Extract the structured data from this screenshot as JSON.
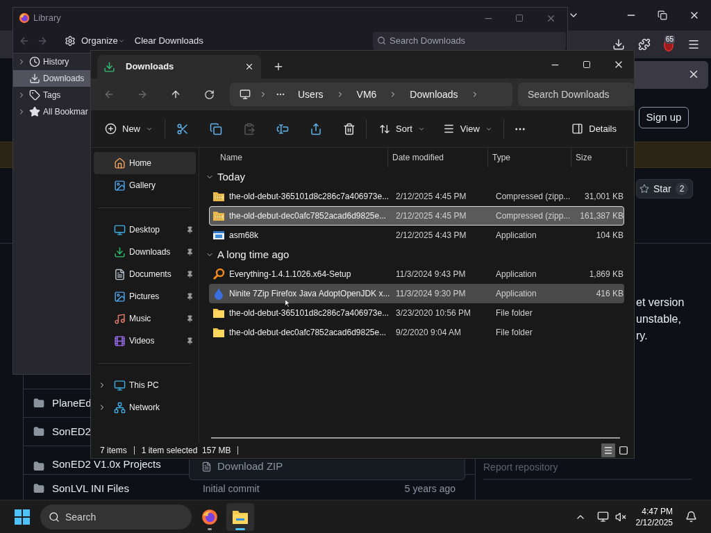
{
  "browser": {
    "toolbar_badge": "65",
    "sign_up": "Sign up",
    "star": {
      "label": "Star",
      "count": "2"
    },
    "about_lines": [
      "et version",
      "unstable,",
      "ry."
    ],
    "file_rows": [
      {
        "name": "PlaneEd"
      },
      {
        "name": "SonED2"
      },
      {
        "name": "SonED2 V1.0x Projects"
      },
      {
        "name": "SonLVL INI Files",
        "message": "Initial commit",
        "age": "5 years ago"
      }
    ],
    "menu_item": "Download ZIP",
    "report": "Report repository"
  },
  "library": {
    "title": "Library",
    "organize": "Organize",
    "clear": "Clear Downloads",
    "search_placeholder": "Search Downloads",
    "sidebar": [
      {
        "label": "History",
        "expandable": true,
        "selected": false
      },
      {
        "label": "Downloads",
        "expandable": false,
        "selected": true
      },
      {
        "label": "Tags",
        "expandable": true,
        "selected": false
      },
      {
        "label": "All Bookmar",
        "expandable": true,
        "selected": false
      }
    ]
  },
  "explorer": {
    "tab": "Downloads",
    "crumbs": [
      "Users",
      "VM6",
      "Downloads"
    ],
    "search_placeholder": "Search Downloads",
    "commands": {
      "new": "New",
      "sort": "Sort",
      "view": "View",
      "details": "Details"
    },
    "icon_buttons": [
      {
        "disabled": false
      },
      {
        "disabled": false
      },
      {
        "disabled": true
      },
      {
        "disabled": false
      },
      {
        "disabled": false
      },
      {
        "disabled": false
      }
    ],
    "nav_sections": [
      {
        "items": [
          {
            "label": "Home",
            "selected": true,
            "pinned": false,
            "expandable": false
          },
          {
            "label": "Gallery",
            "selected": false,
            "pinned": false,
            "expandable": false
          }
        ]
      },
      {
        "items": [
          {
            "label": "Desktop",
            "selected": false,
            "pinned": true,
            "expandable": false
          },
          {
            "label": "Downloads",
            "selected": false,
            "pinned": true,
            "expandable": false
          },
          {
            "label": "Documents",
            "selected": false,
            "pinned": true,
            "expandable": false
          },
          {
            "label": "Pictures",
            "selected": false,
            "pinned": true,
            "expandable": false
          },
          {
            "label": "Music",
            "selected": false,
            "pinned": true,
            "expandable": false
          },
          {
            "label": "Videos",
            "selected": false,
            "pinned": true,
            "expandable": false
          }
        ]
      },
      {
        "items": [
          {
            "label": "This PC",
            "selected": false,
            "pinned": false,
            "expandable": true
          },
          {
            "label": "Network",
            "selected": false,
            "pinned": false,
            "expandable": true
          }
        ]
      }
    ],
    "columns": [
      "Name",
      "Date modified",
      "Type",
      "Size"
    ],
    "groups": [
      {
        "label": "Today",
        "expanded": true,
        "rows": [
          {
            "kind": "zip",
            "name": "the-old-debut-365101d8c286c7a406973e...",
            "date": "2/12/2025 4:45 PM",
            "type": "Compressed (zipp...",
            "size": "31,001 KB",
            "selected": false,
            "hovered": false
          },
          {
            "kind": "zip",
            "name": "the-old-debut-dec0afc7852acad6d9825e...",
            "date": "2/12/2025 4:45 PM",
            "type": "Compressed (zipp...",
            "size": "161,387 KB",
            "selected": true,
            "hovered": false
          },
          {
            "kind": "app",
            "name": "asm68k",
            "date": "2/12/2025 4:43 PM",
            "type": "Application",
            "size": "104 KB",
            "selected": false,
            "hovered": false
          }
        ]
      },
      {
        "label": "A long time ago",
        "expanded": true,
        "rows": [
          {
            "kind": "search",
            "name": "Everything-1.4.1.1026.x64-Setup",
            "date": "11/3/2024 9:43 PM",
            "type": "Application",
            "size": "1,869 KB",
            "selected": false,
            "hovered": false
          },
          {
            "kind": "installer",
            "name": "Ninite 7Zip Firefox Java AdoptOpenJDK x...",
            "date": "11/3/2024 9:30 PM",
            "type": "Application",
            "size": "416 KB",
            "selected": false,
            "hovered": true
          },
          {
            "kind": "folder",
            "name": "the-old-debut-365101d8c286c7a406973e...",
            "date": "3/23/2020 10:56 PM",
            "type": "File folder",
            "selected": false,
            "hovered": false
          },
          {
            "kind": "folder",
            "name": "the-old-debut-dec0afc7852acad6d9825e...",
            "date": "9/2/2020 9:04 AM",
            "type": "File folder",
            "selected": false,
            "hovered": false
          }
        ]
      }
    ],
    "status": {
      "count": "7 items",
      "selection": "1 item selected  157 MB"
    },
    "view_modes": [
      {
        "selected": true
      },
      {
        "selected": false
      }
    ]
  },
  "taskbar": {
    "search_placeholder": "Search",
    "apps": [
      {
        "selected": false
      },
      {
        "selected": true
      }
    ],
    "time": "4:47 PM",
    "date": "2/12/2025"
  }
}
